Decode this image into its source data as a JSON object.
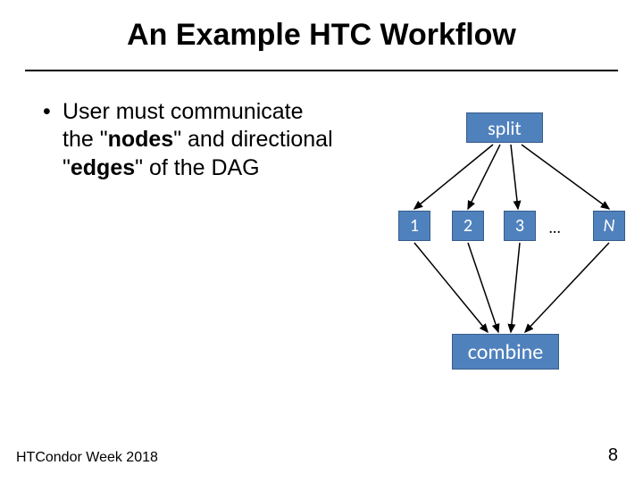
{
  "title": "An Example HTC Workflow",
  "bullet": {
    "pre": "User must communicate the \"",
    "b1": "nodes",
    "mid": "\" and directional \"",
    "b2": "edges",
    "post": "\" of the DAG"
  },
  "diagram": {
    "split": "split",
    "n1": "1",
    "n2": "2",
    "n3": "3",
    "dots": "…",
    "nN": "N",
    "combine": "combine"
  },
  "footer": {
    "left": "HTCondor Week 2018",
    "right": "8"
  }
}
